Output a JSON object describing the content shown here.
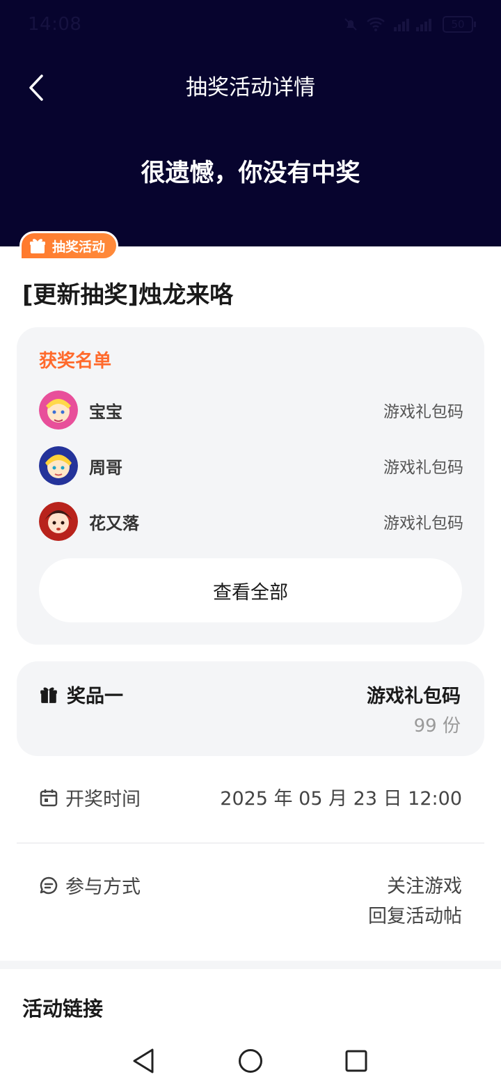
{
  "status_bar": {
    "time": "14:08",
    "battery": "50"
  },
  "header": {
    "title": "抽奖活动详情",
    "result": "很遗憾，你没有中奖"
  },
  "activity": {
    "badge": "抽奖活动",
    "title": "[更新抽奖]烛龙来咯"
  },
  "winners": {
    "heading": "获奖名单",
    "list": [
      {
        "name": "宝宝",
        "prize": "游戏礼包码"
      },
      {
        "name": "周哥",
        "prize": "游戏礼包码"
      },
      {
        "name": "花又落",
        "prize": "游戏礼包码"
      }
    ],
    "view_all": "查看全部"
  },
  "prize": {
    "label": "奖品一",
    "name": "游戏礼包码",
    "count": "99 份"
  },
  "draw_time": {
    "label": "开奖时间",
    "value": "2025 年 05 月 23 日 12:00"
  },
  "participation": {
    "label": "参与方式",
    "methods": [
      "关注游戏",
      "回复活动帖"
    ]
  },
  "links": {
    "title": "活动链接"
  },
  "colors": {
    "header_bg": "#07042e",
    "accent_orange": "#ff6a2c",
    "card_bg": "#f4f5f7"
  },
  "icons": {
    "back": "back-arrow-icon",
    "gift": "gift-icon",
    "calendar": "calendar-icon",
    "chat": "chat-icon",
    "nav_back": "nav-back-icon",
    "nav_home": "nav-home-icon",
    "nav_recents": "nav-recents-icon"
  }
}
